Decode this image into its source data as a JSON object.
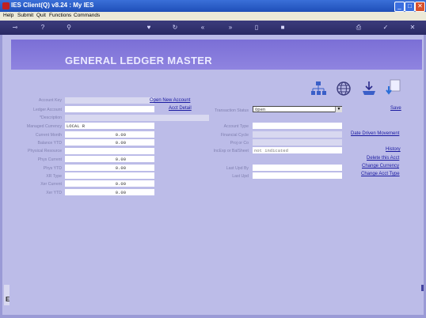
{
  "window": {
    "title": "IES Client(Q) v8.24 : My IES"
  },
  "menu": [
    "Help",
    "Submit",
    "Quit",
    "Functions",
    "Commands"
  ],
  "toolbar_icons": [
    "back-key-icon",
    "help-icon",
    "search-icon",
    "heart-icon",
    "refresh-icon",
    "rewind-icon",
    "forward-icon",
    "doc-icon",
    "stop-icon",
    "print-icon",
    "check-icon",
    "close-icon"
  ],
  "page_title": "GENERAL LEDGER MASTER",
  "left_labels": [
    "Account Key",
    "Ledger Account",
    "*Description",
    "Managed Currency",
    "Current Month",
    "Balance YTD",
    "Physical Resource",
    "Phys Current",
    "Phys YTD",
    "XR Type",
    "Xer Current",
    "Xer YTD"
  ],
  "left_values": {
    "managed_currency": "LOCAL R",
    "current_month": "0.00",
    "balance_ytd": "0.00",
    "phys_current": "0.00",
    "phys_ytd": "0.00",
    "xer_current": "0.00",
    "xer_ytd": "0.00"
  },
  "mid_links": {
    "open_new_account": "Open New Account",
    "acct_detail": "Acct Detail"
  },
  "right_labels": {
    "transaction_status": "Transaction Status",
    "account_type": "Account Type",
    "financial_cycle": "Financial Cycle",
    "proj_or_co": "Proj or Co",
    "incexp_balsheet": "IncExp or BalSheet",
    "last_upd_by": "Last Upd By",
    "last_upd": "Last Upd"
  },
  "right_values": {
    "transaction_status": "Open",
    "incexp_balsheet": "not indicated"
  },
  "actions": {
    "save": "Save",
    "date_driven_movement": "Date Driven Movement",
    "history": "History",
    "delete_this_acct": "Delete this Acct",
    "change_currency": "Change Currency",
    "change_acct_type": "Change Acct Type"
  },
  "colors": {
    "accent": "#7b6fd6",
    "background": "#bcbce8",
    "link": "#1a1aa0"
  }
}
